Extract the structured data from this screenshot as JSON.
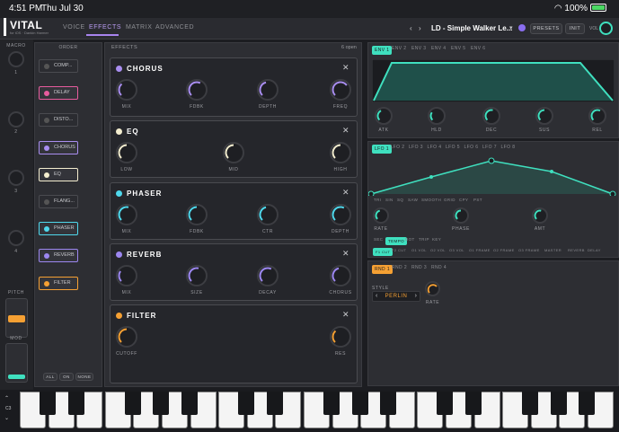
{
  "status": {
    "time": "4:51 PM",
    "date": "Thu Jul 30",
    "battery": "100%"
  },
  "app": {
    "name": "VITAL",
    "subtitle": "for iOS · Dankin Harmer"
  },
  "tabs": [
    "VOICE",
    "EFFECTS",
    "MATRIX",
    "ADVANCED"
  ],
  "active_tab": "EFFECTS",
  "preset": {
    "name": "LD - Simple Walker Le...",
    "presets_label": "PRESETS",
    "init_label": "INIT",
    "vol_label": "VOL"
  },
  "macro": {
    "title": "MACRO",
    "labels": [
      "1",
      "2",
      "3",
      "4"
    ]
  },
  "pitch_label": "PITCH",
  "mod_label": "MOD",
  "order": {
    "title": "ORDER",
    "items": [
      {
        "label": "COMP...",
        "color": "#555",
        "enabled": false
      },
      {
        "label": "DELAY",
        "color": "#e75c9e",
        "enabled": true
      },
      {
        "label": "DISTO...",
        "color": "#555",
        "enabled": false
      },
      {
        "label": "CHORUS",
        "color": "#a98ef0",
        "enabled": true
      },
      {
        "label": "EQ",
        "color": "#f3edcf",
        "enabled": true
      },
      {
        "label": "FLANG...",
        "color": "#555",
        "enabled": false
      },
      {
        "label": "PHASER",
        "color": "#4fd8ec",
        "enabled": true
      },
      {
        "label": "REVERB",
        "color": "#9c87f0",
        "enabled": true
      },
      {
        "label": "FILTER",
        "color": "#f5a033",
        "enabled": true
      }
    ],
    "footer": [
      "ALL",
      "ON",
      "NONE"
    ]
  },
  "effects": {
    "title": "EFFECTS",
    "open": "6 open",
    "modules": [
      {
        "name": "CHORUS",
        "color": "#a98ef0",
        "knobs": [
          "MIX",
          "FDBK",
          "DEPTH",
          "FREQ"
        ],
        "levels": [
          0.35,
          0.6,
          0.45,
          0.7
        ]
      },
      {
        "name": "EQ",
        "color": "#f3edcf",
        "knobs": [
          "LOW",
          "MID",
          "HIGH"
        ],
        "levels": [
          0.5,
          0.5,
          0.5
        ]
      },
      {
        "name": "PHASER",
        "color": "#4fd8ec",
        "knobs": [
          "MIX",
          "FDBK",
          "CTR",
          "DEPTH"
        ],
        "levels": [
          0.55,
          0.5,
          0.45,
          0.6
        ]
      },
      {
        "name": "REVERB",
        "color": "#9c87f0",
        "knobs": [
          "MIX",
          "SIZE",
          "DECAY",
          "CHORUS"
        ],
        "levels": [
          0.3,
          0.55,
          0.6,
          0.45
        ]
      },
      {
        "name": "FILTER",
        "color": "#f5a033",
        "knobs": [
          "CUTOFF",
          "RES"
        ],
        "levels": [
          0.5,
          0.35
        ]
      }
    ]
  },
  "env": {
    "tabs": [
      "ENV 1",
      "ENV 2",
      "ENV 3",
      "ENV 4",
      "ENV 5",
      "ENV 6"
    ],
    "knobs": [
      "ATK",
      "HLD",
      "DEC",
      "SUS",
      "REL"
    ]
  },
  "lfo": {
    "tabs": [
      "LFO 1",
      "LFO 2",
      "LFO 3",
      "LFO 4",
      "LFO 5",
      "LFO 6",
      "LFO 7",
      "LFO 8"
    ],
    "shapes": [
      "TRI",
      "SIN",
      "SQ",
      "SAW",
      "SMOOTH",
      "GRID",
      "CPY",
      "PST"
    ],
    "knobs": [
      "RATE",
      "PHASE",
      "AMT"
    ],
    "sync": [
      "SEC",
      "TEMPO",
      "DOT",
      "TRIP",
      "KEY"
    ],
    "targets": [
      "F1 CUT",
      "F2 CUT",
      "O1 VOL",
      "O2 VOL",
      "O3 VOL",
      "O1 FRAME",
      "O2 FRAME",
      "O3 FRAME",
      "MASTER",
      "REVERB",
      "DELAY"
    ]
  },
  "rnd": {
    "tabs": [
      "RND 1",
      "RND 2",
      "RND 3",
      "RND 4"
    ],
    "style_label": "STYLE",
    "style_value": "PERLIN",
    "rate_label": "RATE"
  },
  "keyboard": {
    "octave": "C3"
  }
}
